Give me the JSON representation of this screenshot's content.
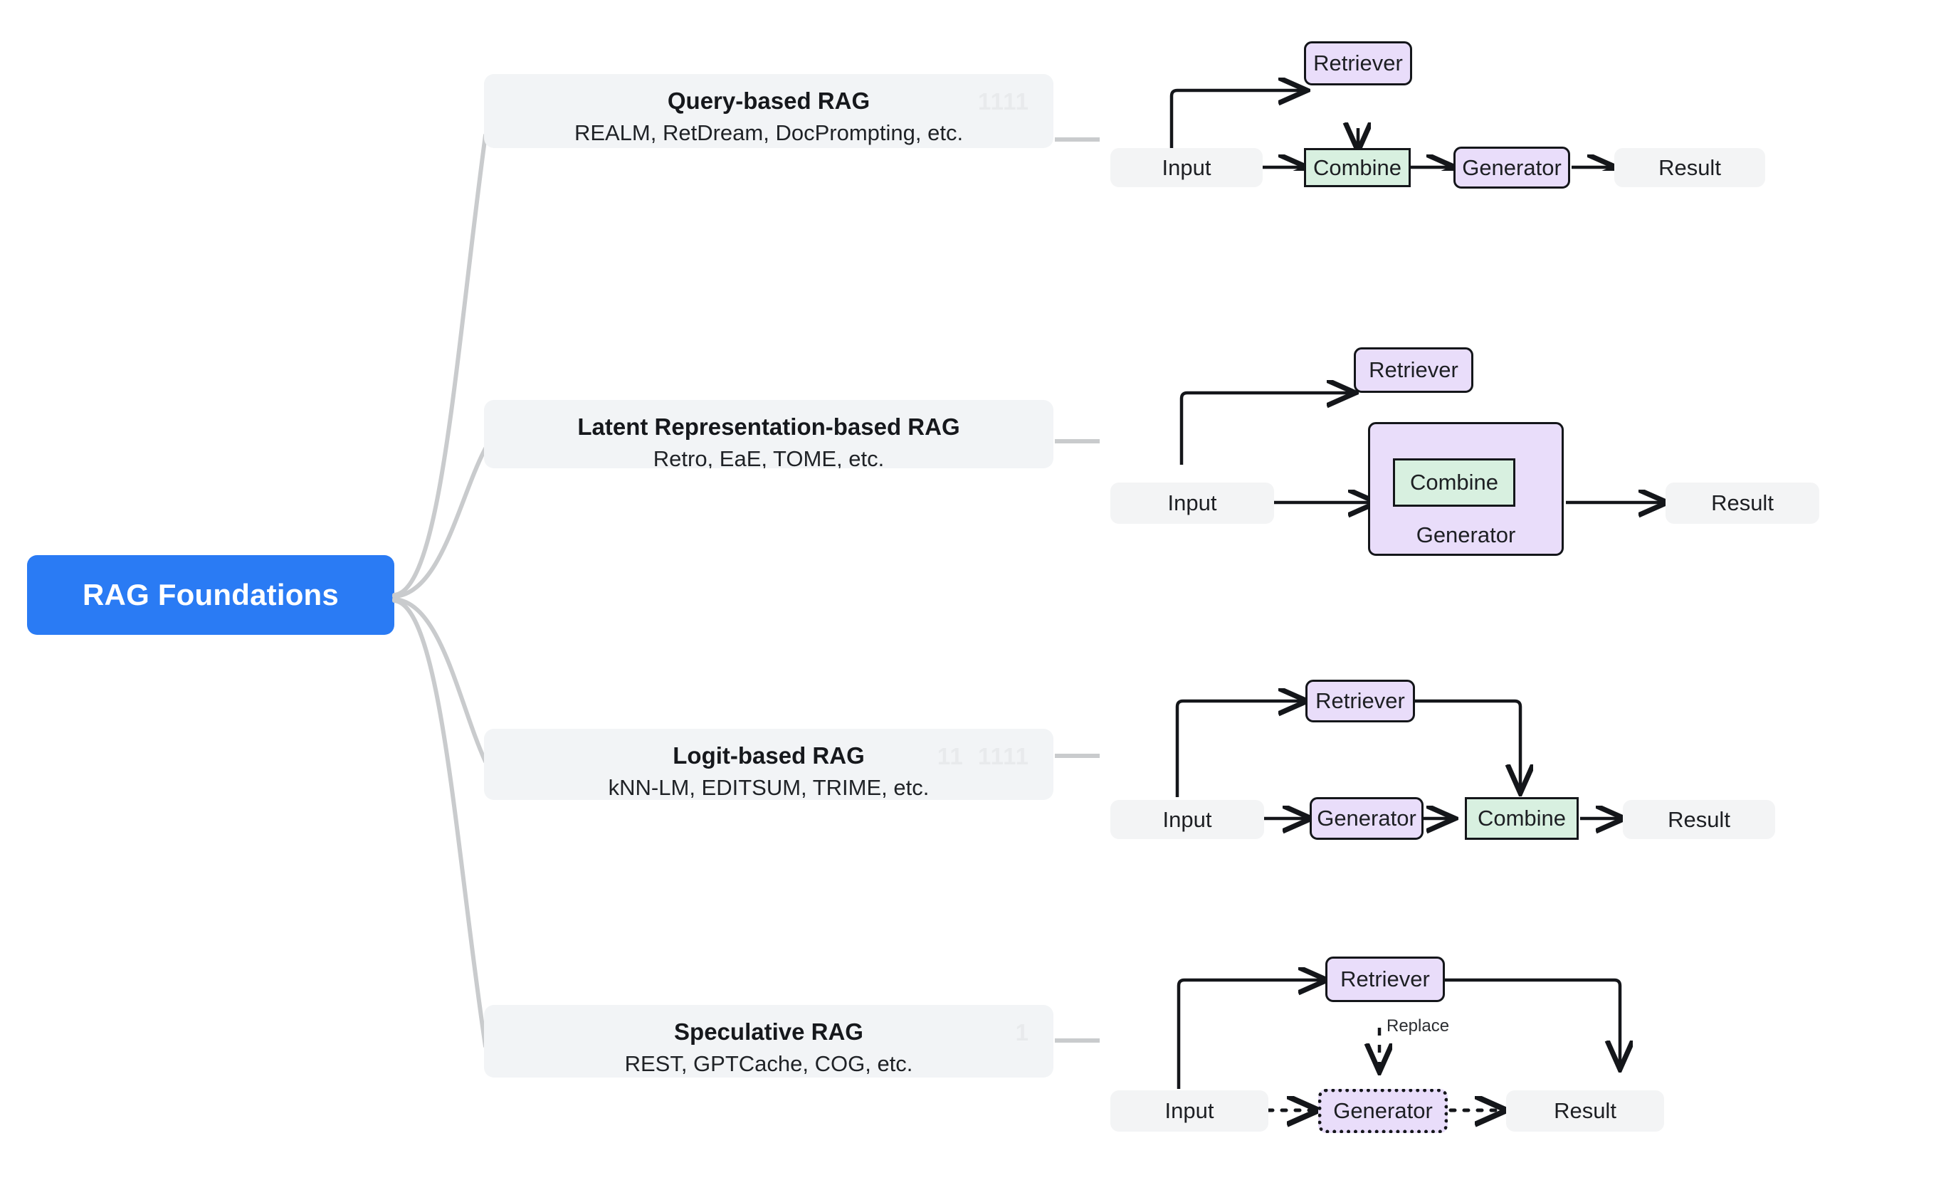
{
  "root": {
    "label": "RAG Foundations",
    "color": "#2a7bf4",
    "text_color": "#ffffff"
  },
  "palette": {
    "card_bg": "#f2f4f6",
    "plain_node_bg": "#f3f4f5",
    "purple_node_bg": "#e9ddfa",
    "green_node_bg": "#d8f0e0",
    "node_border": "#14161a",
    "branch_line": "#c9cbcd",
    "watermark": "#e8eaec"
  },
  "branches": [
    {
      "id": "query-based-rag",
      "title": "Query-based RAG",
      "subtitle": "REALM, RetDream, DocPrompting, etc.",
      "watermark": "1111",
      "flow": {
        "nodes": [
          {
            "id": "input",
            "label": "Input",
            "style": "plain"
          },
          {
            "id": "retriever",
            "label": "Retriever",
            "style": "purple"
          },
          {
            "id": "combine",
            "label": "Combine",
            "style": "green"
          },
          {
            "id": "generator",
            "label": "Generator",
            "style": "purple"
          },
          {
            "id": "result",
            "label": "Result",
            "style": "plain"
          }
        ],
        "edges": [
          {
            "from": "input",
            "to": "retriever",
            "style": "solid",
            "label": ""
          },
          {
            "from": "retriever",
            "to": "combine",
            "style": "solid",
            "label": ""
          },
          {
            "from": "input",
            "to": "combine",
            "style": "solid",
            "label": ""
          },
          {
            "from": "combine",
            "to": "generator",
            "style": "solid",
            "label": ""
          },
          {
            "from": "generator",
            "to": "result",
            "style": "solid",
            "label": ""
          }
        ]
      }
    },
    {
      "id": "latent-representation-based-rag",
      "title": "Latent Representation-based RAG",
      "subtitle": "Retro, EaE, TOME, etc.",
      "watermark": "",
      "flow": {
        "nodes": [
          {
            "id": "input",
            "label": "Input",
            "style": "plain"
          },
          {
            "id": "retriever",
            "label": "Retriever",
            "style": "purple"
          },
          {
            "id": "generator",
            "label": "Generator",
            "style": "group-purple"
          },
          {
            "id": "combine",
            "label": "Combine",
            "style": "green"
          },
          {
            "id": "result",
            "label": "Result",
            "style": "plain"
          }
        ],
        "edges": [
          {
            "from": "input",
            "to": "retriever",
            "style": "solid",
            "label": ""
          },
          {
            "from": "retriever",
            "to": "combine",
            "style": "solid",
            "label": ""
          },
          {
            "from": "input",
            "to": "combine",
            "style": "solid",
            "label": ""
          },
          {
            "from": "combine",
            "to": "result",
            "style": "solid",
            "label": ""
          }
        ],
        "nesting": "combine-inside-generator"
      }
    },
    {
      "id": "logit-based-rag",
      "title": "Logit-based RAG",
      "subtitle": "kNN-LM, EDITSUM, TRIME, etc.",
      "watermark": "11  1111",
      "flow": {
        "nodes": [
          {
            "id": "input",
            "label": "Input",
            "style": "plain"
          },
          {
            "id": "retriever",
            "label": "Retriever",
            "style": "purple"
          },
          {
            "id": "generator",
            "label": "Generator",
            "style": "purple"
          },
          {
            "id": "combine",
            "label": "Combine",
            "style": "green"
          },
          {
            "id": "result",
            "label": "Result",
            "style": "plain"
          }
        ],
        "edges": [
          {
            "from": "input",
            "to": "retriever",
            "style": "solid",
            "label": ""
          },
          {
            "from": "input",
            "to": "generator",
            "style": "solid",
            "label": ""
          },
          {
            "from": "generator",
            "to": "combine",
            "style": "solid",
            "label": ""
          },
          {
            "from": "retriever",
            "to": "combine",
            "style": "solid",
            "label": ""
          },
          {
            "from": "combine",
            "to": "result",
            "style": "solid",
            "label": ""
          }
        ]
      }
    },
    {
      "id": "speculative-rag",
      "title": "Speculative RAG",
      "subtitle": "REST, GPTCache, COG, etc.",
      "watermark": "1",
      "flow": {
        "nodes": [
          {
            "id": "input",
            "label": "Input",
            "style": "plain"
          },
          {
            "id": "retriever",
            "label": "Retriever",
            "style": "purple"
          },
          {
            "id": "generator",
            "label": "Generator",
            "style": "purple-dotted"
          },
          {
            "id": "result",
            "label": "Result",
            "style": "plain"
          }
        ],
        "edges": [
          {
            "from": "input",
            "to": "retriever",
            "style": "solid",
            "label": ""
          },
          {
            "from": "input",
            "to": "generator",
            "style": "dotted",
            "label": ""
          },
          {
            "from": "generator",
            "to": "result",
            "style": "dotted",
            "label": ""
          },
          {
            "from": "retriever",
            "to": "generator",
            "style": "dashed",
            "label": "Replace"
          },
          {
            "from": "retriever",
            "to": "result",
            "style": "solid",
            "label": ""
          }
        ]
      }
    }
  ]
}
